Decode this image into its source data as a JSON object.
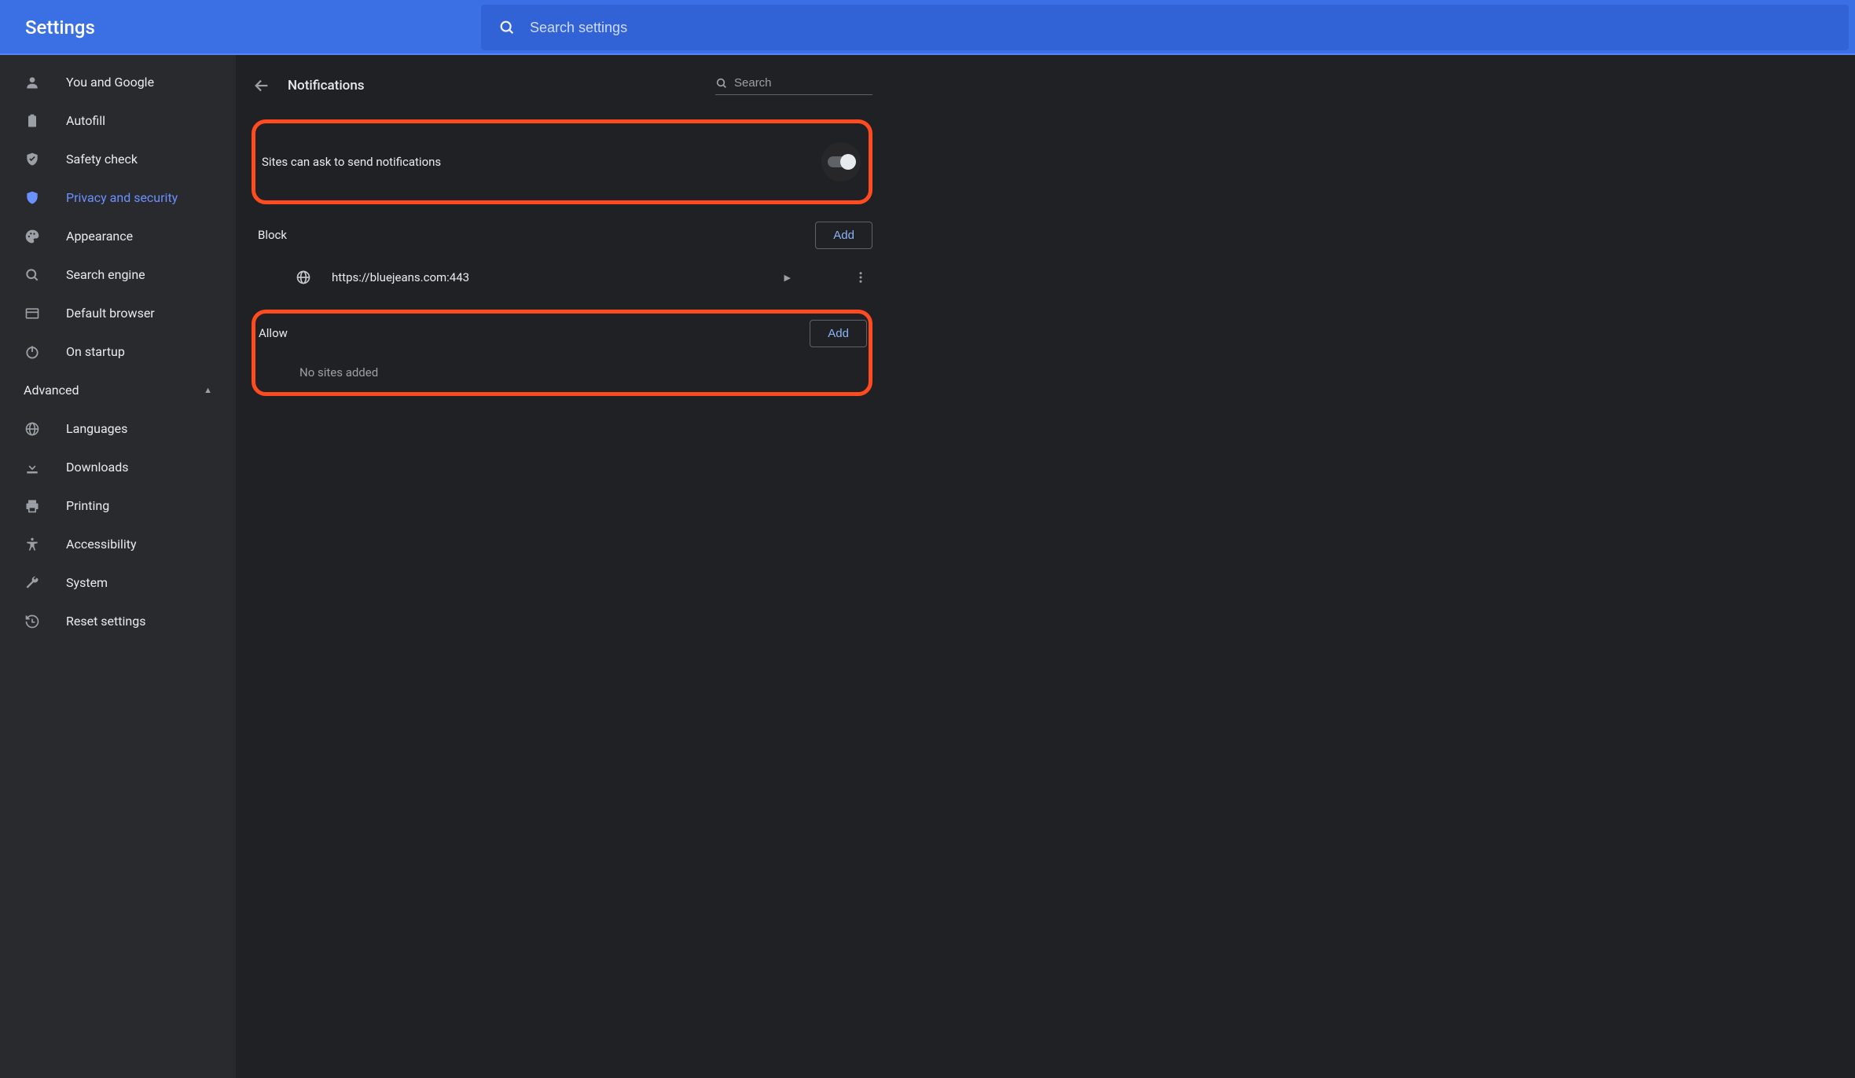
{
  "app": {
    "title": "Settings"
  },
  "search": {
    "placeholder": "Search settings"
  },
  "sidebar": {
    "items": [
      {
        "icon": "person",
        "label": "You and Google"
      },
      {
        "icon": "clipboard",
        "label": "Autofill"
      },
      {
        "icon": "shield-check",
        "label": "Safety check"
      },
      {
        "icon": "shield",
        "label": "Privacy and security",
        "active": true
      },
      {
        "icon": "palette",
        "label": "Appearance"
      },
      {
        "icon": "search",
        "label": "Search engine"
      },
      {
        "icon": "browser",
        "label": "Default browser"
      },
      {
        "icon": "power",
        "label": "On startup"
      }
    ],
    "advanced_label": "Advanced",
    "advanced_items": [
      {
        "icon": "globe",
        "label": "Languages"
      },
      {
        "icon": "download",
        "label": "Downloads"
      },
      {
        "icon": "print",
        "label": "Printing"
      },
      {
        "icon": "accessibility",
        "label": "Accessibility"
      },
      {
        "icon": "wrench",
        "label": "System"
      },
      {
        "icon": "restore",
        "label": "Reset settings"
      }
    ]
  },
  "panel": {
    "title": "Notifications",
    "search_placeholder": "Search",
    "ask_label": "Sites can ask to send notifications",
    "block_label": "Block",
    "allow_label": "Allow",
    "add_label": "Add",
    "blocked_sites": [
      {
        "url": "https://bluejeans.com:443"
      }
    ],
    "allow_empty": "No sites added"
  }
}
